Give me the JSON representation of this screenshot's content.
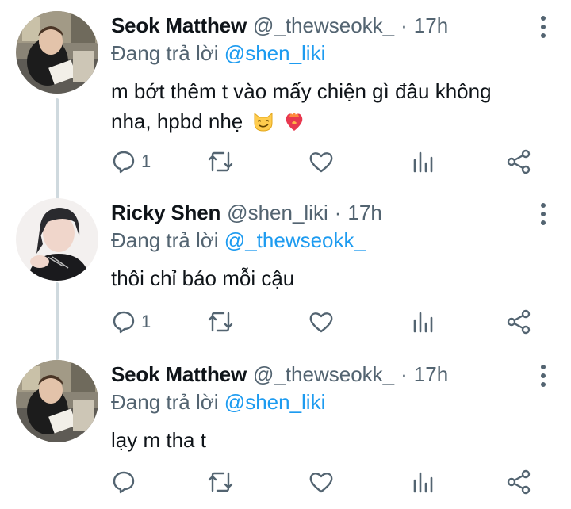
{
  "tweets": [
    {
      "name": "Seok Matthew",
      "handle": "@_thewseokk_",
      "dot": "·",
      "time": "17h",
      "replying_prefix": "Đang trả lời",
      "replying_to": "@shen_liki",
      "text": "m bớt thêm t vào mấy chiện gì đâu không nha, hpbd nhẹ",
      "emojis": [
        "smirking-cat-emoji",
        "heart-on-fire-emoji"
      ],
      "reply_count": "1",
      "icons": {
        "reply": "reply-icon",
        "retweet": "retweet-icon",
        "like": "like-icon",
        "views": "views-icon",
        "share": "share-icon",
        "more": "more-icon"
      }
    },
    {
      "name": "Ricky Shen",
      "handle": "@shen_liki",
      "dot": "·",
      "time": "17h",
      "replying_prefix": "Đang trả lời",
      "replying_to": "@_thewseokk_",
      "text": "thôi chỉ báo mỗi cậu",
      "emojis": [],
      "reply_count": "1",
      "icons": {
        "reply": "reply-icon",
        "retweet": "retweet-icon",
        "like": "like-icon",
        "views": "views-icon",
        "share": "share-icon",
        "more": "more-icon"
      }
    },
    {
      "name": "Seok Matthew",
      "handle": "@_thewseokk_",
      "dot": "·",
      "time": "17h",
      "replying_prefix": "Đang trả lời",
      "replying_to": "@shen_liki",
      "text": "lạy m tha t",
      "emojis": [],
      "reply_count": "",
      "icons": {
        "reply": "reply-icon",
        "retweet": "retweet-icon",
        "like": "like-icon",
        "views": "views-icon",
        "share": "share-icon",
        "more": "more-icon"
      }
    }
  ],
  "colors": {
    "text": "#0f1419",
    "secondary": "#536471",
    "link": "#1d9bf0",
    "thread_line": "#cfd9de"
  }
}
